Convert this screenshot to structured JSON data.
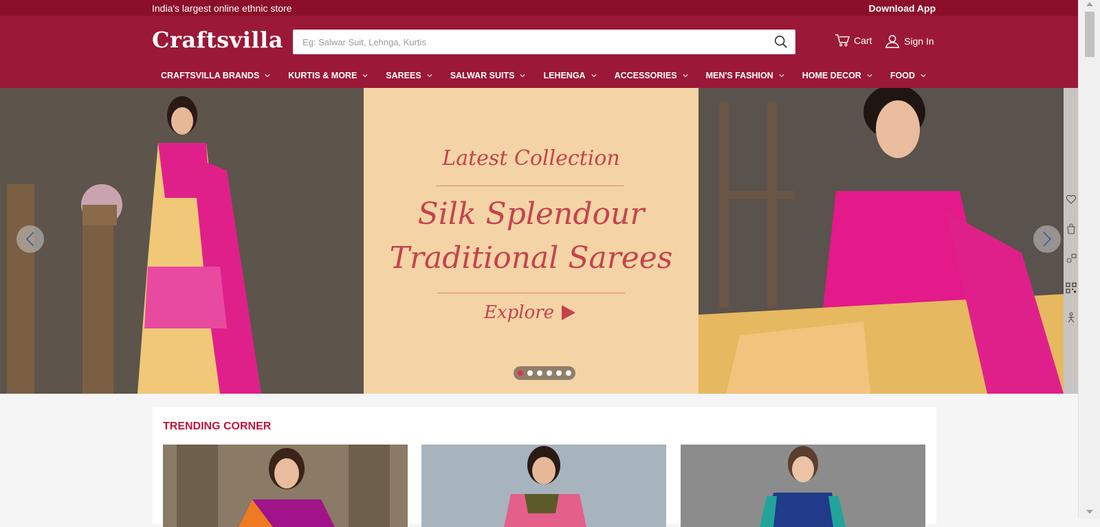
{
  "topstrip": {
    "tagline": "India's largest online ethnic store",
    "download": "Download App"
  },
  "header": {
    "logo": "Craftsvilla",
    "search_placeholder": "Eg: Salwar Suit, Lehnga, Kurtis",
    "cart_label": "Cart",
    "signin_label": "Sign In"
  },
  "nav": {
    "items": [
      {
        "label": "CRAFTSVILLA BRANDS"
      },
      {
        "label": "KURTIS & MORE"
      },
      {
        "label": "SAREES"
      },
      {
        "label": "SALWAR SUITS"
      },
      {
        "label": "LEHENGA"
      },
      {
        "label": "ACCESSORIES"
      },
      {
        "label": "MEN'S FASHION"
      },
      {
        "label": "HOME DECOR"
      },
      {
        "label": "FOOD"
      }
    ]
  },
  "hero": {
    "heading": "Latest Collection",
    "line1": "Silk Splendour",
    "line2": "Traditional Sarees",
    "cta": "Explore",
    "slide_count": 6,
    "active_slide": 1
  },
  "trending": {
    "title": "TRENDING CORNER"
  },
  "colors": {
    "brand": "#9b1838",
    "brand_dark": "#8b0f2b",
    "accent": "#c0163c",
    "hero_text": "#c5434d"
  },
  "icons": [
    "search-icon",
    "cart-icon",
    "user-icon",
    "chevron-down-icon",
    "arrow-left-icon",
    "arrow-right-icon",
    "heart-icon",
    "shopping-bag-icon",
    "compare-icon",
    "qr-code-icon",
    "tailor-icon",
    "play-icon"
  ]
}
